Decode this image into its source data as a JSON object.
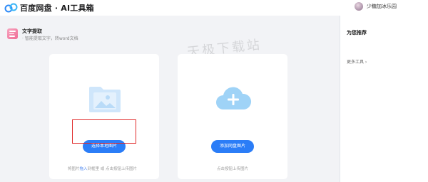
{
  "header": {
    "app_title": "百度网盘 · AI工具箱",
    "username": "少糖加冰乐园"
  },
  "tool": {
    "name": "文字提取",
    "description": "· 智能提取文字，转word文档"
  },
  "cards": {
    "local": {
      "button_label": "选择本地图片",
      "hint_prefix": "将图片",
      "hint_link": "拖入",
      "hint_middle": "到框里   或   点击按钮上传图片"
    },
    "cloud": {
      "button_label": "添加网盘图片",
      "hint": "点击按钮上传图片"
    }
  },
  "sidebar": {
    "title": "为您推荐",
    "more_tools": "更多工具 ›"
  },
  "watermark": "天极下载站",
  "colors": {
    "accent": "#2b7df7",
    "highlight": "#e02b2b",
    "background": "#f2f3f6"
  }
}
